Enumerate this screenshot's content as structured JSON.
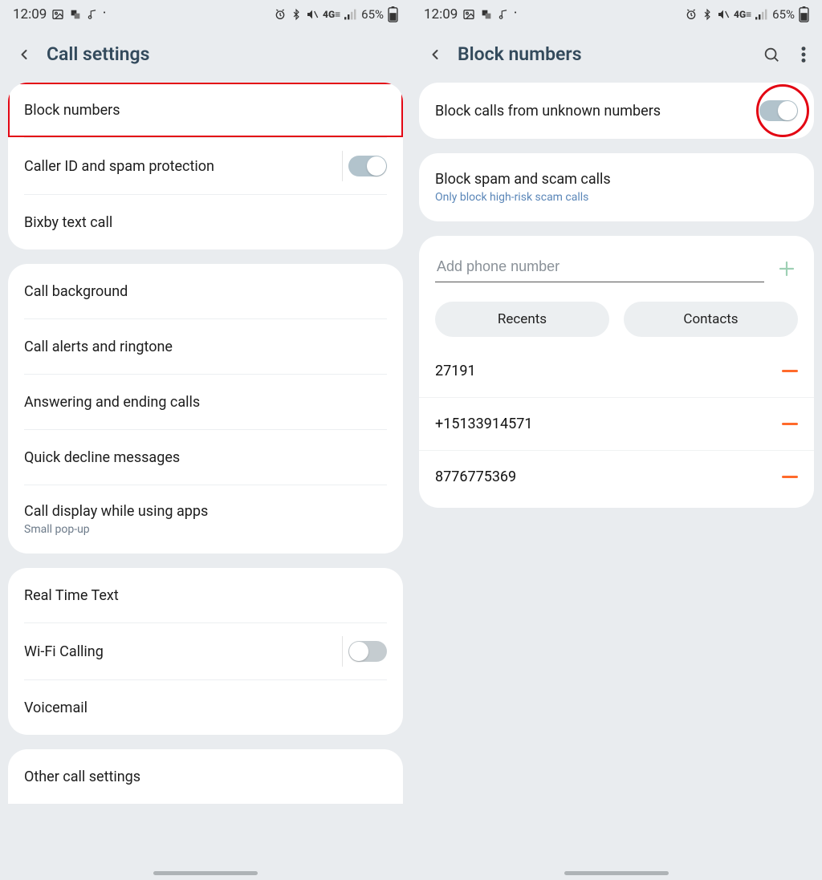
{
  "status": {
    "time": "12:09",
    "battery": "65%",
    "network": "4G≡"
  },
  "left": {
    "title": "Call settings",
    "groups": [
      {
        "rows": [
          {
            "title": "Block numbers",
            "highlight": true
          },
          {
            "title": "Caller ID and spam protection",
            "toggle": "on"
          },
          {
            "title": "Bixby text call"
          }
        ]
      },
      {
        "rows": [
          {
            "title": "Call background"
          },
          {
            "title": "Call alerts and ringtone"
          },
          {
            "title": "Answering and ending calls"
          },
          {
            "title": "Quick decline messages"
          },
          {
            "title": "Call display while using apps",
            "sub": "Small pop-up"
          }
        ]
      },
      {
        "rows": [
          {
            "title": "Real Time Text"
          },
          {
            "title": "Wi-Fi Calling",
            "toggle": "off"
          },
          {
            "title": "Voicemail"
          }
        ]
      },
      {
        "rows": [
          {
            "title": "Other call settings"
          }
        ]
      }
    ]
  },
  "right": {
    "title": "Block numbers",
    "unknown": {
      "label": "Block calls from unknown numbers",
      "toggle": "on"
    },
    "spam": {
      "title": "Block spam and scam calls",
      "sub": "Only block high-risk scam calls"
    },
    "add_placeholder": "Add phone number",
    "recents_label": "Recents",
    "contacts_label": "Contacts",
    "blocked": [
      "27191",
      "+15133914571",
      "8776775369"
    ]
  }
}
